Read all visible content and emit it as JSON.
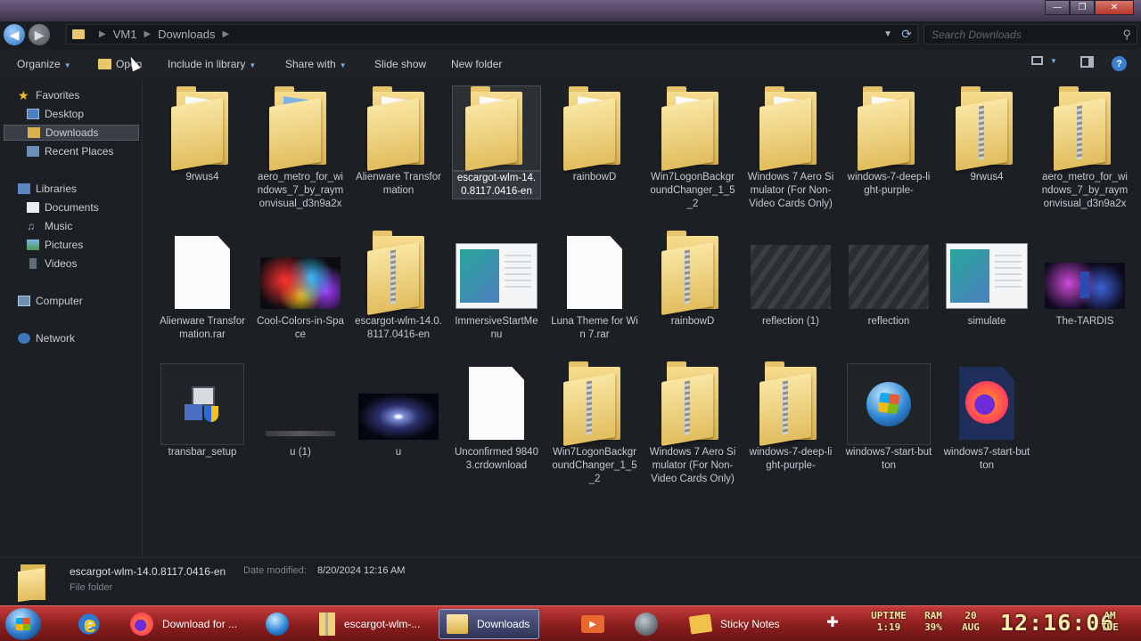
{
  "window": {
    "minimize": "—",
    "maximize": "❐",
    "close": "✕"
  },
  "address": {
    "crumbs": [
      "VM1",
      "Downloads"
    ],
    "search_placeholder": "Search Downloads"
  },
  "toolbar": {
    "organize": "Organize",
    "open": "Open",
    "include_in_library": "Include in library",
    "share_with": "Share with",
    "slide_show": "Slide show",
    "new_folder": "New folder"
  },
  "nav": {
    "favorites": "Favorites",
    "desktop": "Desktop",
    "downloads": "Downloads",
    "recent_places": "Recent Places",
    "libraries": "Libraries",
    "documents": "Documents",
    "music": "Music",
    "pictures": "Pictures",
    "videos": "Videos",
    "computer": "Computer",
    "network": "Network"
  },
  "files": [
    {
      "name": "9rwus4",
      "kind": "folder"
    },
    {
      "name": "aero_metro_for_windows_7_by_raymonvisual_d3n9a2x",
      "kind": "folder"
    },
    {
      "name": "Alienware Transformation",
      "kind": "folder"
    },
    {
      "name": "escargot-wlm-14.0.8117.0416-en",
      "kind": "folder"
    },
    {
      "name": "rainbowD",
      "kind": "folder"
    },
    {
      "name": "Win7LogonBackgroundChanger_1_5_2",
      "kind": "folder"
    },
    {
      "name": "Windows 7 Aero Simulator (For Non-Video Cards Only)",
      "kind": "folder"
    },
    {
      "name": "windows-7-deep-light-purple-",
      "kind": "folder"
    },
    {
      "name": "9rwus4",
      "kind": "zip"
    },
    {
      "name": "aero_metro_for_windows_7_by_raymonvisual_d3n9a2x",
      "kind": "zip"
    },
    {
      "name": "Alienware Transformation.rar",
      "kind": "doc"
    },
    {
      "name": "Cool-Colors-in-Space",
      "kind": "image"
    },
    {
      "name": "escargot-wlm-14.0.8117.0416-en",
      "kind": "zip"
    },
    {
      "name": "ImmersiveStartMenu",
      "kind": "image"
    },
    {
      "name": "Luna Theme for Win 7.rar",
      "kind": "doc"
    },
    {
      "name": "rainbowD",
      "kind": "zip"
    },
    {
      "name": "reflection (1)",
      "kind": "image"
    },
    {
      "name": "reflection",
      "kind": "image"
    },
    {
      "name": "simulate",
      "kind": "image"
    },
    {
      "name": "The-TARDIS",
      "kind": "image"
    },
    {
      "name": "transbar_setup",
      "kind": "app"
    },
    {
      "name": "u (1)",
      "kind": "image"
    },
    {
      "name": "u",
      "kind": "image"
    },
    {
      "name": "Unconfirmed 98403.crdownload",
      "kind": "doc"
    },
    {
      "name": "Win7LogonBackgroundChanger_1_5_2",
      "kind": "zip"
    },
    {
      "name": "Windows 7 Aero Simulator (For Non-Video Cards Only)",
      "kind": "zip"
    },
    {
      "name": "windows-7-deep-light-purple-",
      "kind": "zip"
    },
    {
      "name": "windows7-start-button",
      "kind": "image"
    },
    {
      "name": "windows7-start-button",
      "kind": "firefox-doc"
    }
  ],
  "details": {
    "name": "escargot-wlm-14.0.8117.0416-en",
    "date_label": "Date modified:",
    "date_value": "8/20/2024 12:16 AM",
    "type": "File folder"
  },
  "taskbar": {
    "firefox": "Download for ...",
    "escargot": "escargot-wlm-...",
    "downloads": "Downloads",
    "sticky_notes": "Sticky Notes"
  },
  "tray": {
    "uptime_label": "UPTIME",
    "uptime_value": "1:19",
    "ram_label": "RAM",
    "ram_value": "39%",
    "date_day": "20",
    "date_month": "AUG",
    "clock": "12:16:06",
    "ampm": "AM",
    "weekday": "TUE"
  }
}
